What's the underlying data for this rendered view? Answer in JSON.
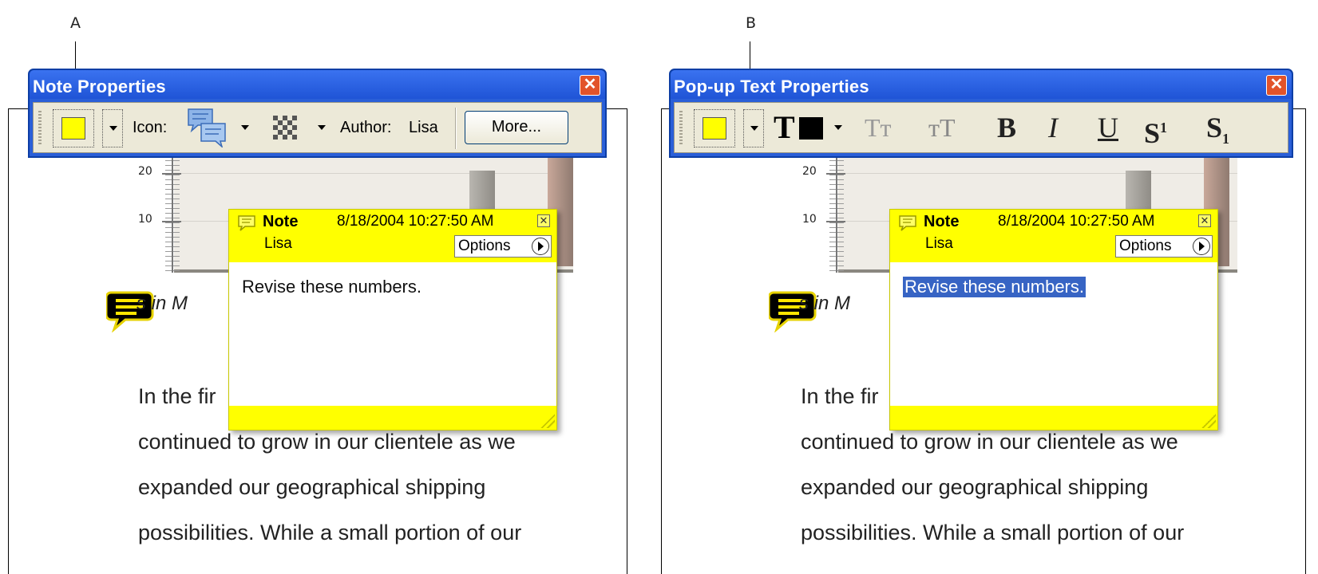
{
  "callouts": {
    "left": "A",
    "right": "B"
  },
  "left_panel": {
    "toolbar": {
      "title": "Note Properties",
      "close_glyph": "✕",
      "icon_label": "Icon:",
      "author_label": "Author:",
      "author_value": "Lisa",
      "more_label": "More...",
      "color": "#ffff00"
    },
    "chart": {
      "tick_20": "20",
      "tick_10": "10"
    },
    "doc": {
      "heading_fragment": "s in M",
      "lines": [
        "In the fir",
        "continued to grow in our clientele as we",
        "expanded our geographical shipping",
        "possibilities. While a small portion of our"
      ]
    },
    "popup": {
      "title": "Note",
      "author": "Lisa",
      "datetime": "8/18/2004 10:27:50 AM",
      "close_glyph": "✕",
      "options_label": "Options",
      "body": "Revise these numbers.",
      "selected": false
    }
  },
  "right_panel": {
    "toolbar": {
      "title": "Pop-up Text Properties",
      "close_glyph": "✕",
      "text_color_glyph": "T",
      "color": "#ffff00",
      "text_color": "#000000",
      "format_buttons": {
        "decrease_size": "Tт",
        "increase_size": "тT",
        "bold": "B",
        "italic": "I",
        "underline": "U",
        "superscript_base": "S",
        "superscript_mark": "1",
        "subscript_base": "S",
        "subscript_mark": "1"
      }
    },
    "chart": {
      "tick_20": "20",
      "tick_10": "10"
    },
    "doc": {
      "heading_fragment": "s in M",
      "lines": [
        "In the fir",
        "continued to grow in our clientele as we",
        "expanded our geographical shipping",
        "possibilities. While a small portion of our"
      ]
    },
    "popup": {
      "title": "Note",
      "author": "Lisa",
      "datetime": "8/18/2004 10:27:50 AM",
      "close_glyph": "✕",
      "options_label": "Options",
      "body": "Revise these numbers.",
      "selected": true
    }
  }
}
